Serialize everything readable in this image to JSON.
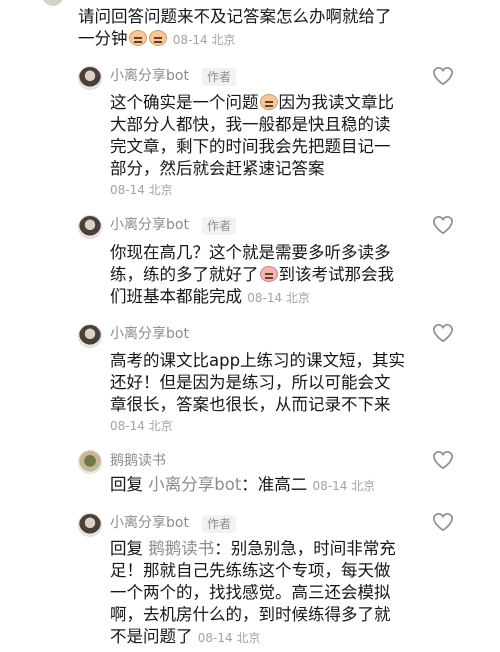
{
  "top_comment": {
    "text_line1": "请问回答问题来不及记答案怎么办啊就给了",
    "text_line2": "一分钟",
    "emoji_names": [
      "sweat-smile-emoji",
      "sweat-smile-emoji"
    ],
    "meta": "08-14 北京"
  },
  "replies": [
    {
      "username": "小离分享bot",
      "author_tag": "作者",
      "lines": [
        "这个确实是一个问题",
        "因为我读文章比",
        "大部分人都快，我一般都是快且稳的读",
        "完文章，剩下的时间我会先把题目记一",
        "部分，然后就会赶紧速记答案"
      ],
      "meta": "08-14 北京"
    },
    {
      "username": "小离分享bot",
      "author_tag": "作者",
      "lines": [
        "你现在高几？这个就是需要多听多读多",
        "练，练的多了就好了",
        "到该考试那会我",
        "们班基本都能完成"
      ],
      "meta": "08-14 北京"
    },
    {
      "username": "小离分享bot",
      "author_tag": "",
      "lines": [
        "高考的课文比app上练习的课文短，其实",
        "还好！但是因为是练习，所以可能会文",
        "章很长，答案也很长，从而记录不下来"
      ],
      "meta": "08-14 北京"
    },
    {
      "username": "鹅鹅读书",
      "author_tag": "",
      "reply_word": "回复",
      "reply_target": "小离分享bot",
      "reply_text": "：准高二",
      "meta": "08-14 北京"
    },
    {
      "username": "小离分享bot",
      "author_tag": "作者",
      "reply_word": "回复",
      "reply_target": "鹅鹅读书",
      "lines": [
        "：别急别急，时间非常充",
        "足！那就自己先练练这个专项，每天做",
        "一个两个的，找找感觉。高三还会模拟",
        "啊，去机房什么的，到时候练得多了就",
        "不是问题了"
      ],
      "meta": "08-14 北京"
    }
  ],
  "icons": {
    "like": "heart-outline-icon",
    "avatar": "user-avatar"
  },
  "colors": {
    "text": "#161616",
    "secondary": "#8c8c8c",
    "meta": "#a3a3a3"
  }
}
